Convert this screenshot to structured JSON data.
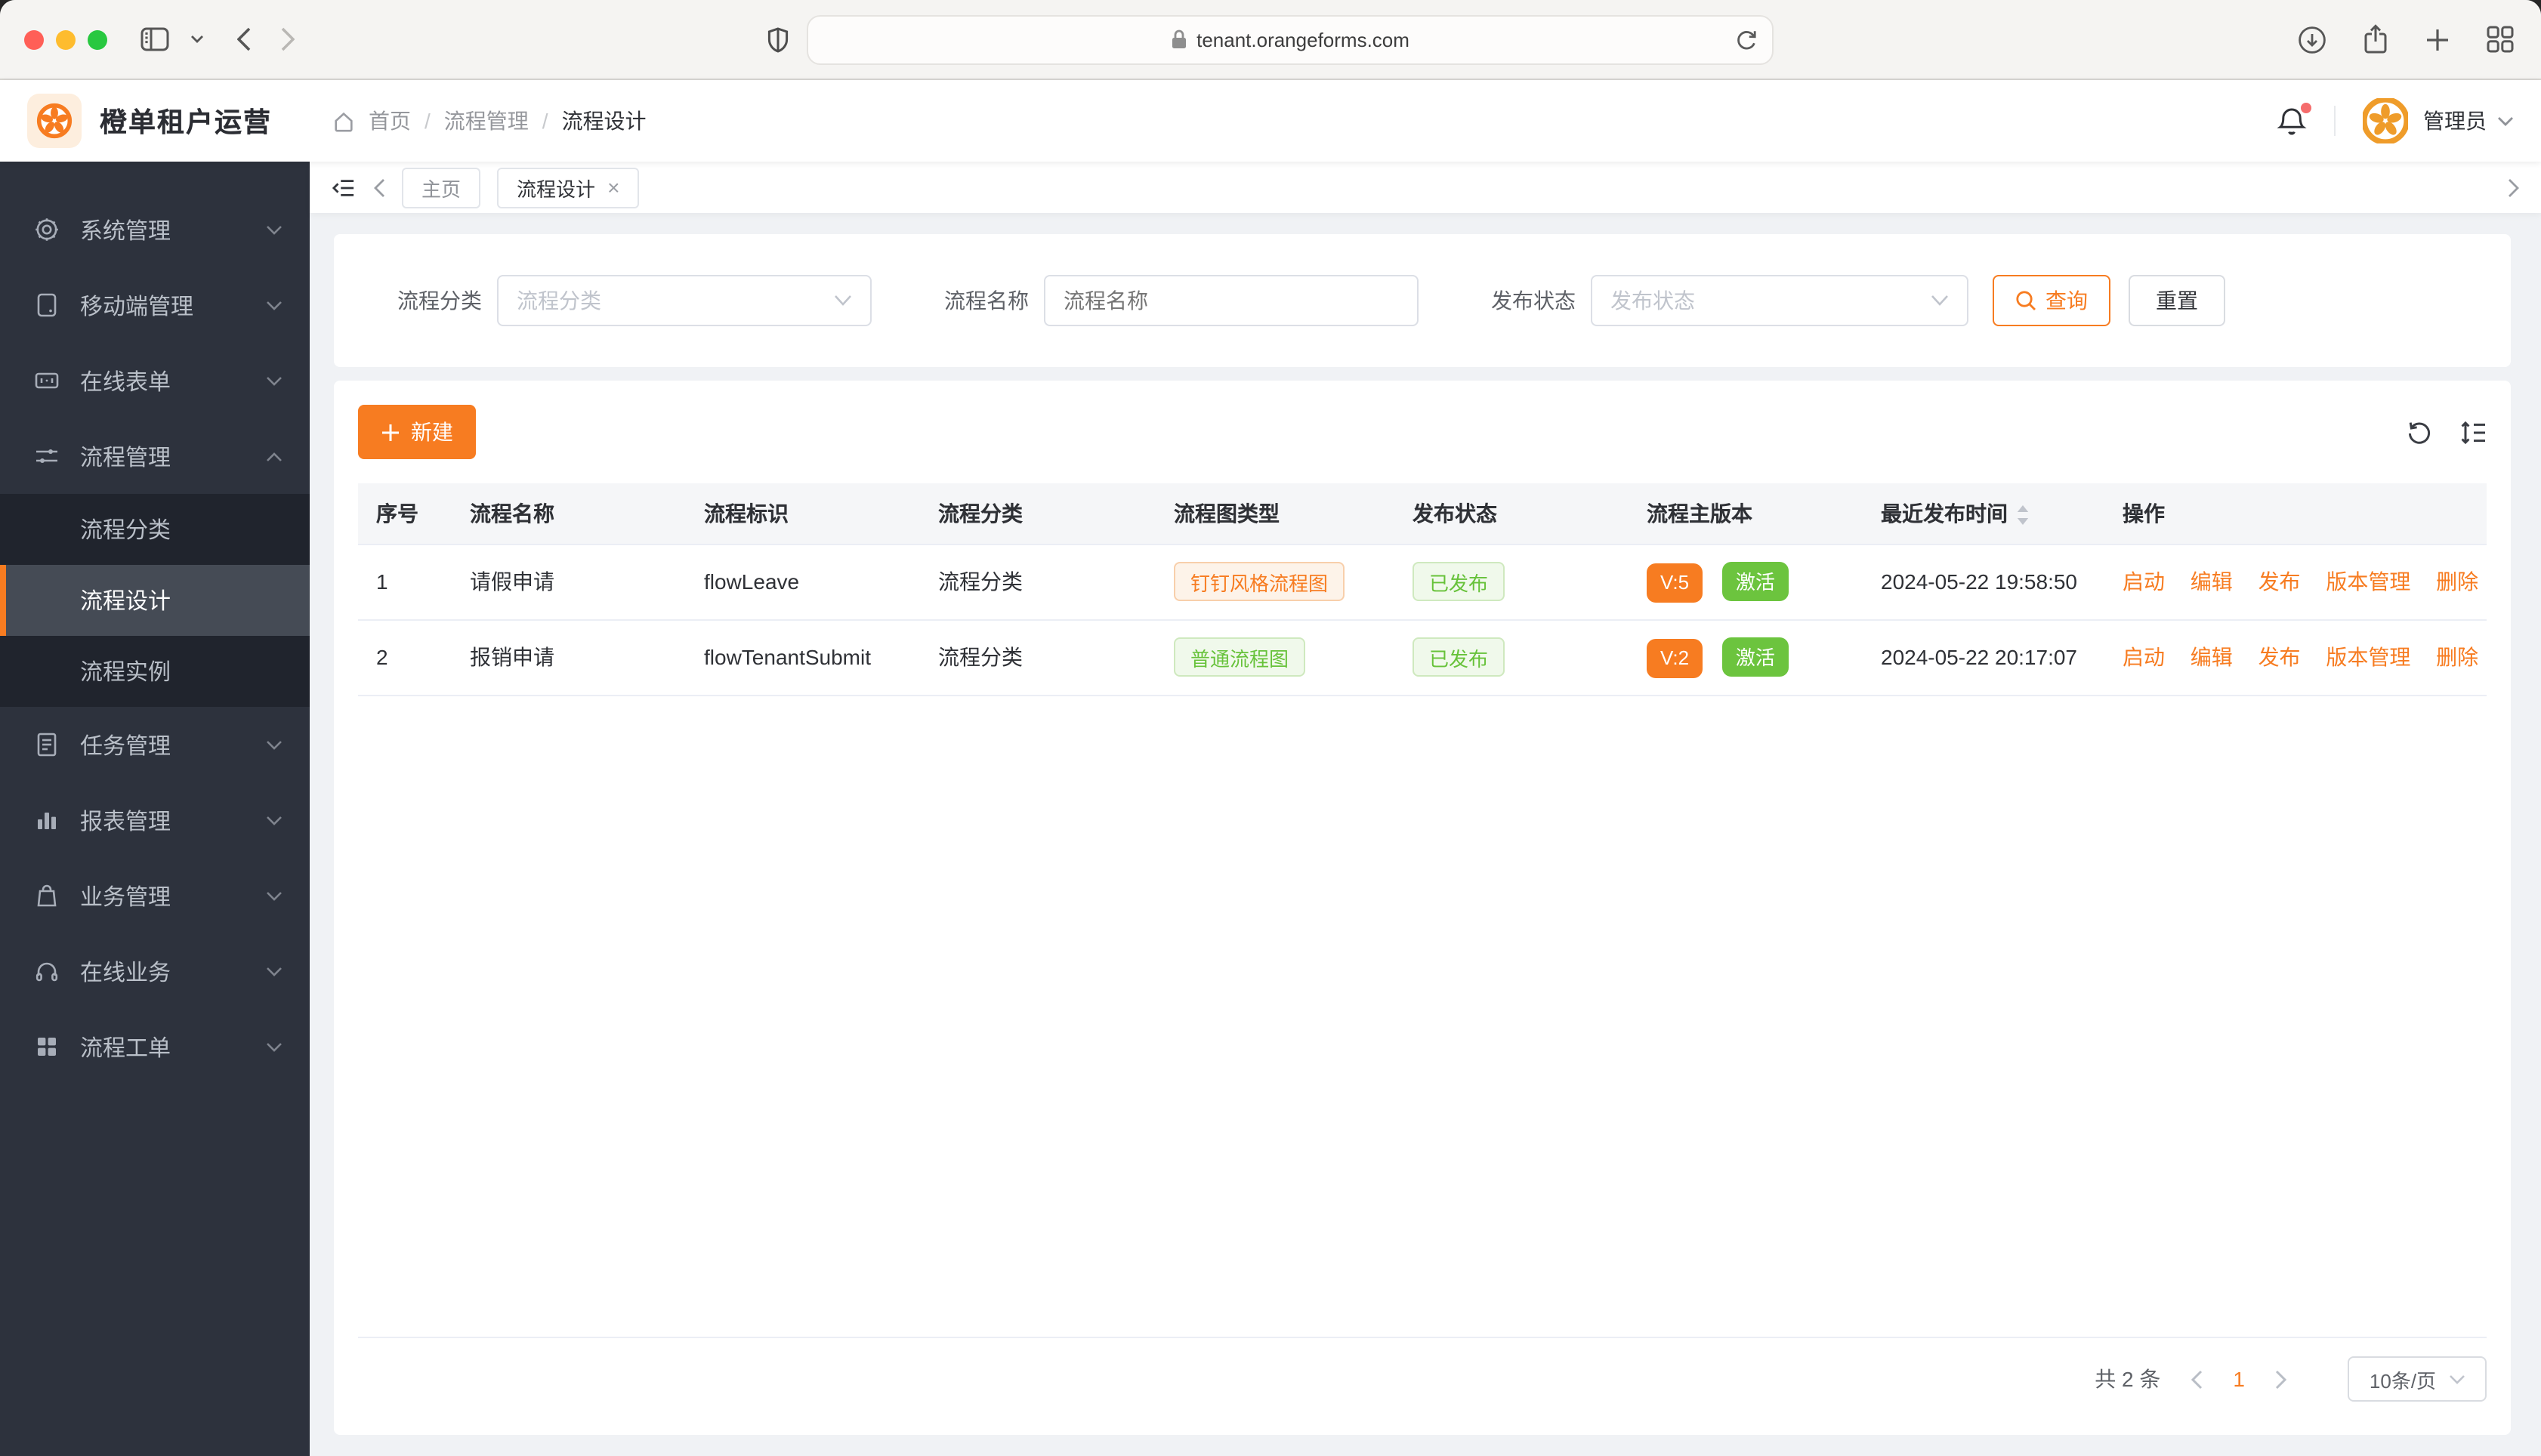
{
  "browser": {
    "url": "tenant.orangeforms.com"
  },
  "app": {
    "title": "橙单租户运营",
    "breadcrumb": {
      "home": "首页",
      "section": "流程管理",
      "current": "流程设计"
    },
    "user": {
      "name": "管理员"
    }
  },
  "sidebar": {
    "items": [
      {
        "label": "系统管理",
        "icon": "gear-icon"
      },
      {
        "label": "移动端管理",
        "icon": "mobile-icon"
      },
      {
        "label": "在线表单",
        "icon": "form-icon"
      },
      {
        "label": "流程管理",
        "icon": "sliders-icon",
        "expanded": true
      },
      {
        "label": "任务管理",
        "icon": "tasks-icon"
      },
      {
        "label": "报表管理",
        "icon": "chart-icon"
      },
      {
        "label": "业务管理",
        "icon": "bag-icon"
      },
      {
        "label": "在线业务",
        "icon": "headset-icon"
      },
      {
        "label": "流程工单",
        "icon": "grid-icon"
      }
    ],
    "process_submenu": [
      {
        "label": "流程分类",
        "active": false
      },
      {
        "label": "流程设计",
        "active": true
      },
      {
        "label": "流程实例",
        "active": false
      }
    ]
  },
  "tabs": {
    "items": [
      {
        "label": "主页",
        "active": false
      },
      {
        "label": "流程设计",
        "active": true,
        "closable": true
      }
    ]
  },
  "filters": {
    "category": {
      "label": "流程分类",
      "placeholder": "流程分类"
    },
    "name": {
      "label": "流程名称",
      "placeholder": "流程名称"
    },
    "status": {
      "label": "发布状态",
      "placeholder": "发布状态"
    },
    "search_button": "查询",
    "reset_button": "重置"
  },
  "toolbar": {
    "new_button": "新建"
  },
  "table": {
    "columns": [
      "序号",
      "流程名称",
      "流程标识",
      "流程分类",
      "流程图类型",
      "发布状态",
      "流程主版本",
      "最近发布时间",
      "操作"
    ],
    "rows": [
      {
        "index": "1",
        "name": "请假申请",
        "key": "flowLeave",
        "category": "流程分类",
        "diagram_type": "钉钉风格流程图",
        "diagram_style": "orange",
        "publish_status": "已发布",
        "version": "V:5",
        "version_state": "激活",
        "published_at": "2024-05-22 19:58:50"
      },
      {
        "index": "2",
        "name": "报销申请",
        "key": "flowTenantSubmit",
        "category": "流程分类",
        "diagram_type": "普通流程图",
        "diagram_style": "green",
        "publish_status": "已发布",
        "version": "V:2",
        "version_state": "激活",
        "published_at": "2024-05-22 20:17:07"
      }
    ],
    "actions": [
      "启动",
      "编辑",
      "发布",
      "版本管理",
      "删除"
    ]
  },
  "pagination": {
    "total": "共 2 条",
    "page": "1",
    "page_size": "10条/页"
  },
  "glyphs": {
    "close": "×",
    "breadcrumb_sep": "/"
  },
  "colors": {
    "accent": "#f77c21",
    "success": "#67c23a",
    "success_solid": "#6cc43e",
    "notification_dot": "#f56c6c",
    "sidebar_bg": "#2d323d",
    "sidebar_submenu_bg": "#20242d",
    "sidebar_active_bg": "#454b55"
  }
}
